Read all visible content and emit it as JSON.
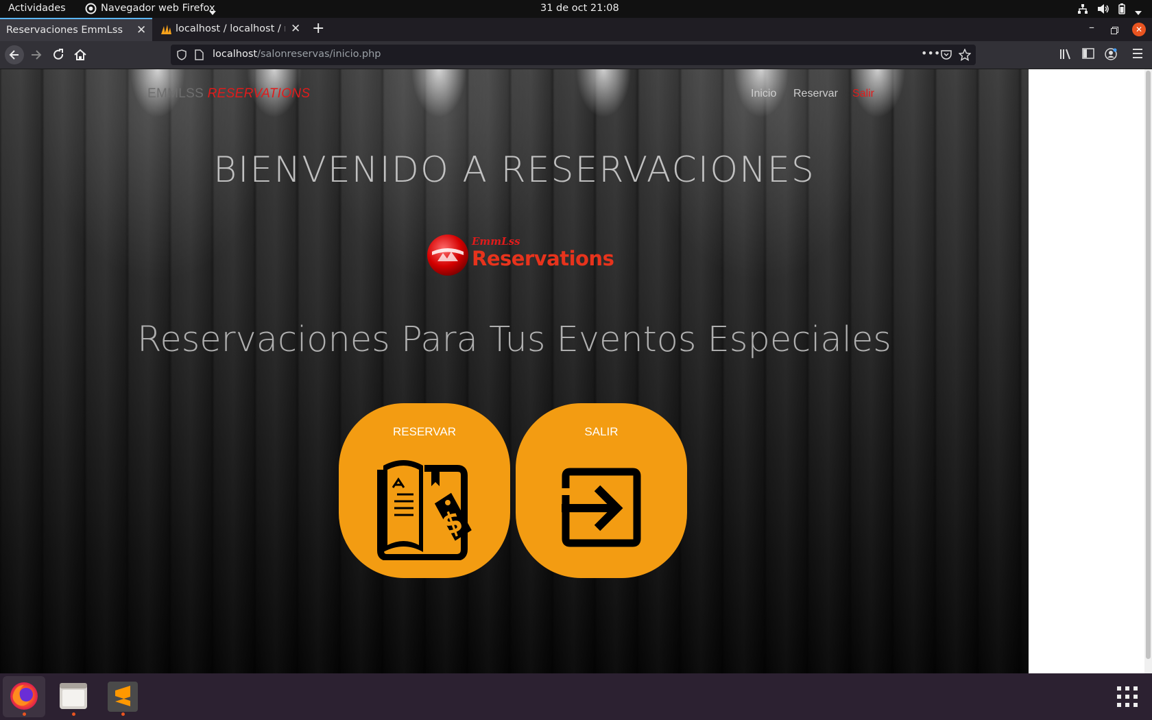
{
  "system_bar": {
    "activities": "Actividades",
    "app_menu": "Navegador web Firefox",
    "clock": "31 de oct  21:08"
  },
  "browser": {
    "tabs": [
      {
        "label": "Reservaciones EmmLss",
        "active": true
      },
      {
        "label": "localhost / localhost / re",
        "active": false
      }
    ],
    "url_host": "localhost",
    "url_path": "/salonreservas/inicio.php"
  },
  "site": {
    "brand_plain": "EMMLSS",
    "brand_accent": "RESERVATIONS",
    "menu": [
      "Inicio",
      "Reservar",
      "Salir"
    ],
    "hero_title": "BIENVENIDO A RESERVACIONES",
    "logo_top": "EmmLss",
    "logo_main": "Reservations",
    "hero_subtitle": "Reservaciones Para Tus Eventos Especiales",
    "cards": [
      {
        "label": "RESERVAR",
        "icon": "reservation-book-icon"
      },
      {
        "label": "SALIR",
        "icon": "exit-arrow-icon"
      }
    ]
  },
  "colors": {
    "accent_red": "#e01b1b",
    "card_orange": "#f39c12",
    "ubuntu_orange": "#e95420"
  }
}
